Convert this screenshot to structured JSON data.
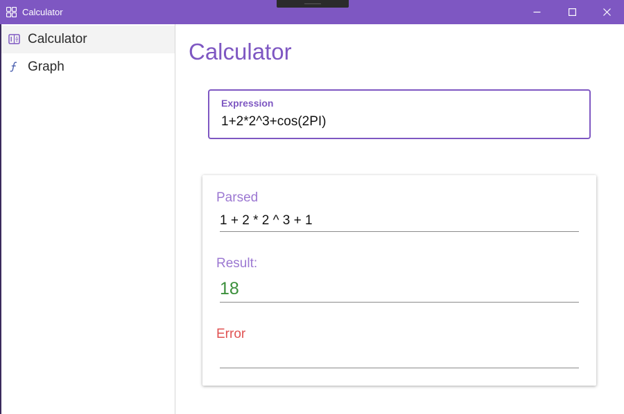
{
  "window": {
    "title": "Calculator",
    "accent_color": "#7e57c2",
    "icons": {
      "app": "calculator-app-icon",
      "minimize": "minimize-icon",
      "maximize": "maximize-icon",
      "close": "close-icon"
    }
  },
  "sidebar": {
    "items": [
      {
        "label": "Calculator",
        "icon": "calculator-icon",
        "active": true
      },
      {
        "label": "Graph",
        "icon": "function-icon",
        "active": false
      }
    ]
  },
  "main": {
    "title": "Calculator",
    "expression": {
      "label": "Expression",
      "value": "1+2*2^3+cos(2PI)"
    },
    "results": {
      "parsed_label": "Parsed",
      "parsed_value": "1 + 2 * 2 ^ 3 + 1",
      "result_label": "Result:",
      "result_value": "18",
      "error_label": "Error",
      "error_value": ""
    },
    "colors": {
      "label": "#9c78d2",
      "result": "#3b8f3b",
      "error": "#e05252"
    }
  }
}
